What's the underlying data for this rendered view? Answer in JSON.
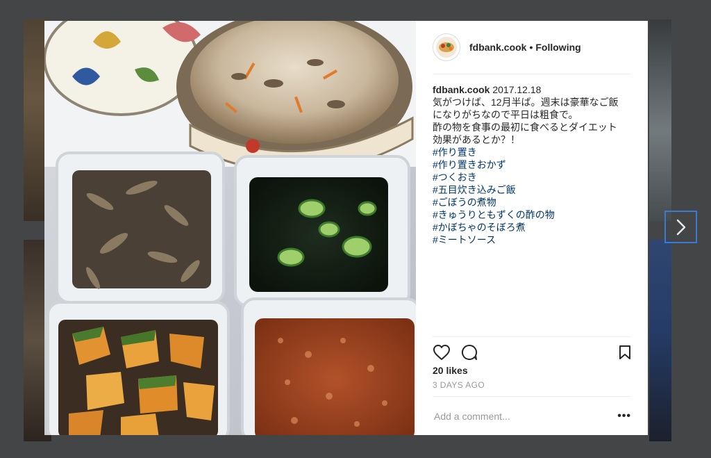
{
  "post": {
    "username": "fdbank.cook",
    "follow_state": "Following",
    "separator": "•",
    "caption": {
      "username": "fdbank.cook",
      "date": "2017.12.18",
      "lines": [
        "気がつけば、12月半ば。週末は豪華なご飯",
        "になりがちなので平日は粗食で。",
        "酢の物を食事の最初に食べるとダイエット",
        "効果があるとか？！"
      ],
      "hashtags": [
        "#作り置き",
        "#作り置きおかず",
        "#つくおき",
        "#五目炊き込みご飯",
        "#ごぼうの煮物",
        "#きゅうりともずくの酢の物",
        "#かぼちゃのそぼろ煮",
        "#ミートソース"
      ]
    },
    "likes": "20 likes",
    "time": "3 DAYS AGO",
    "comment_placeholder": "Add a comment...",
    "more_label": "•••"
  },
  "icons": {
    "like": "heart-icon",
    "comment": "comment-icon",
    "save": "bookmark-icon",
    "next": "chevron-right-icon"
  },
  "colors": {
    "link": "#003569",
    "muted": "#999999",
    "backdrop": "#444546",
    "focus": "#3b7ad1"
  }
}
